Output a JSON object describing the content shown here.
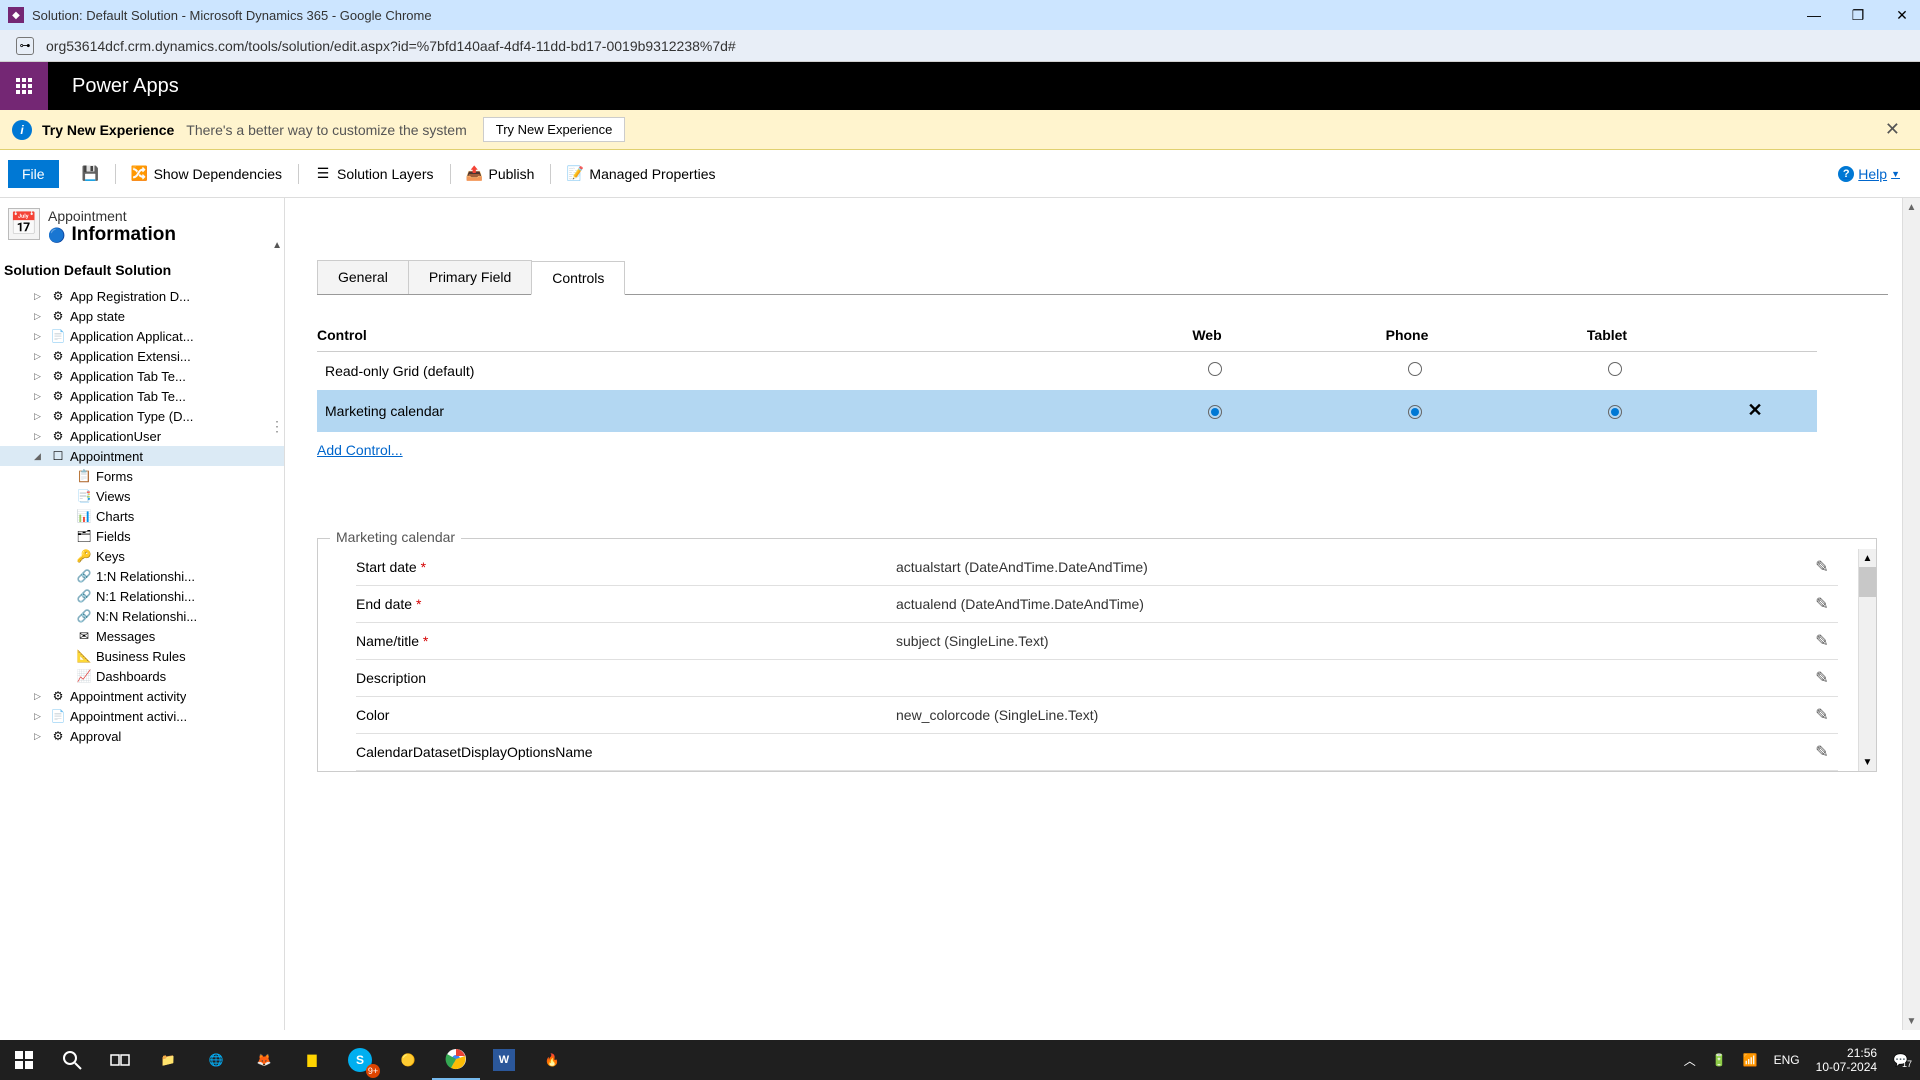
{
  "window": {
    "title": "Solution: Default Solution - Microsoft Dynamics 365 - Google Chrome",
    "url": "org53614dcf.crm.dynamics.com/tools/solution/edit.aspx?id=%7bfd140aaf-4df4-11dd-bd17-0019b9312238%7d#"
  },
  "header": {
    "brand": "Power Apps"
  },
  "banner": {
    "strong": "Try New Experience",
    "text": "There's a better way to customize the system",
    "button": "Try New Experience"
  },
  "toolbar": {
    "file": "File",
    "show_deps": "Show Dependencies",
    "solution_layers": "Solution Layers",
    "publish": "Publish",
    "managed_props": "Managed Properties",
    "help": "Help"
  },
  "sidebar": {
    "entity": "Appointment",
    "info": "Information",
    "solution": "Solution Default Solution",
    "tree": [
      {
        "label": "App Registration D...",
        "icon": "⚙"
      },
      {
        "label": "App state",
        "icon": "⚙"
      },
      {
        "label": "Application Applicat...",
        "icon": "📄"
      },
      {
        "label": "Application Extensi...",
        "icon": "⚙"
      },
      {
        "label": "Application Tab Te...",
        "icon": "⚙"
      },
      {
        "label": "Application Tab Te...",
        "icon": "⚙"
      },
      {
        "label": "Application Type (D...",
        "icon": "⚙"
      },
      {
        "label": "ApplicationUser",
        "icon": "⚙"
      },
      {
        "label": "Appointment",
        "icon": "☐",
        "selected": true,
        "expanded": true
      },
      {
        "label": "Appointment activity",
        "icon": "⚙"
      },
      {
        "label": "Appointment activi...",
        "icon": "📄"
      },
      {
        "label": "Approval",
        "icon": "⚙"
      }
    ],
    "children": [
      {
        "label": "Forms",
        "icon": "📋"
      },
      {
        "label": "Views",
        "icon": "📑"
      },
      {
        "label": "Charts",
        "icon": "📊"
      },
      {
        "label": "Fields",
        "icon": "🗂"
      },
      {
        "label": "Keys",
        "icon": "🔑"
      },
      {
        "label": "1:N Relationshi...",
        "icon": "🔗"
      },
      {
        "label": "N:1 Relationshi...",
        "icon": "🔗"
      },
      {
        "label": "N:N Relationshi...",
        "icon": "🔗"
      },
      {
        "label": "Messages",
        "icon": "✉"
      },
      {
        "label": "Business Rules",
        "icon": "📐"
      },
      {
        "label": "Dashboards",
        "icon": "📈"
      }
    ]
  },
  "tabs": [
    "General",
    "Primary Field",
    "Controls"
  ],
  "active_tab": "Controls",
  "grid": {
    "headers": {
      "control": "Control",
      "web": "Web",
      "phone": "Phone",
      "tablet": "Tablet"
    },
    "rows": [
      {
        "name": "Read-only Grid (default)",
        "web": false,
        "phone": false,
        "tablet": false,
        "selected": false,
        "removable": false
      },
      {
        "name": "Marketing calendar",
        "web": true,
        "phone": true,
        "tablet": true,
        "selected": true,
        "removable": true
      }
    ],
    "add_control": "Add Control..."
  },
  "fieldset": {
    "legend": "Marketing calendar",
    "rows": [
      {
        "label": "Start date",
        "required": true,
        "value": "actualstart (DateAndTime.DateAndTime)"
      },
      {
        "label": "End date",
        "required": true,
        "value": "actualend (DateAndTime.DateAndTime)"
      },
      {
        "label": "Name/title",
        "required": true,
        "value": "subject (SingleLine.Text)"
      },
      {
        "label": "Description",
        "required": false,
        "value": ""
      },
      {
        "label": "Color",
        "required": false,
        "value": "new_colorcode (SingleLine.Text)"
      },
      {
        "label": "CalendarDatasetDisplayOptionsName",
        "required": false,
        "value": ""
      }
    ]
  },
  "taskbar": {
    "lang": "ENG",
    "time": "21:56",
    "date": "10-07-2024",
    "notif": "17"
  }
}
